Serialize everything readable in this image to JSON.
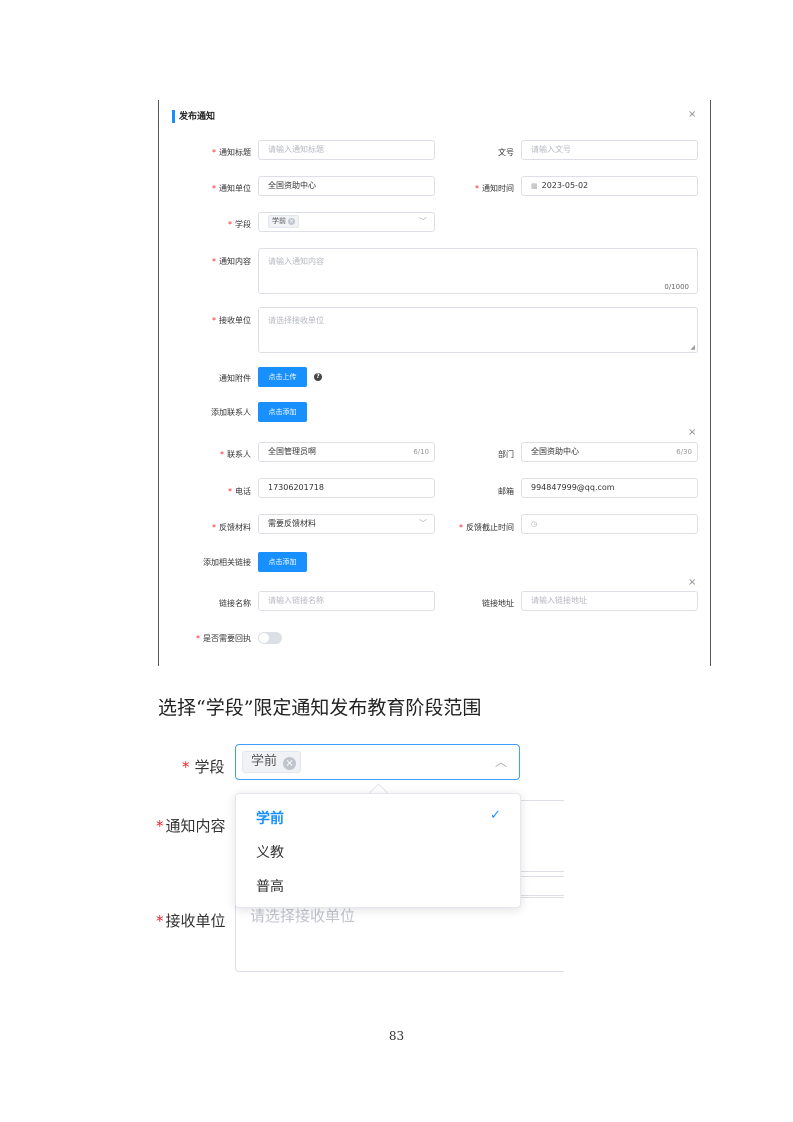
{
  "dialog": {
    "title": "发布通知",
    "close_icon": "×",
    "fields": {
      "title_label": "通知标题",
      "title_placeholder": "请输入通知标题",
      "docno_label": "文号",
      "docno_placeholder": "请输入文号",
      "unit_label": "通知单位",
      "unit_value": "全国资助中心",
      "time_label": "通知时间",
      "time_value": "2023-05-02",
      "stage_label": "学段",
      "stage_tag": "学前",
      "content_label": "通知内容",
      "content_placeholder": "请输入通知内容",
      "content_counter": "0/1000",
      "receiver_label": "接收单位",
      "receiver_placeholder": "请选择接收单位",
      "attach_label": "通知附件",
      "upload_button": "点击上传",
      "add_contact_label": "添加联系人",
      "add_button": "点击添加",
      "contact_label": "联系人",
      "contact_value": "全国管理员啊",
      "contact_counter": "6/10",
      "dept_label": "部门",
      "dept_value": "全国资助中心",
      "dept_counter": "6/30",
      "phone_label": "电话",
      "phone_value": "17306201718",
      "email_label": "邮箱",
      "email_value": "994847999@qq.com",
      "feedback_label": "反馈材料",
      "feedback_value": "需要反馈材料",
      "deadline_label": "反馈截止时间",
      "add_link_label": "添加相关链接",
      "add_link_button": "点击添加",
      "link_name_label": "链接名称",
      "link_name_placeholder": "请输入链接名称",
      "link_url_label": "链接地址",
      "link_url_placeholder": "请输入链接地址",
      "receipt_label": "是否需要回执"
    },
    "required_mark": "*",
    "accent_color": "#1890ff"
  },
  "caption": "选择“学段”限定通知发布教育阶段范围",
  "zoom": {
    "stage_label": "学段",
    "stage_tag": "学前",
    "content_label": "通知内容",
    "receiver_label": "接收单位",
    "receiver_placeholder": "请选择接收单位",
    "options": [
      "学前",
      "义教",
      "普高"
    ],
    "selected": "学前",
    "check_icon": "✓"
  },
  "page_number": "83"
}
